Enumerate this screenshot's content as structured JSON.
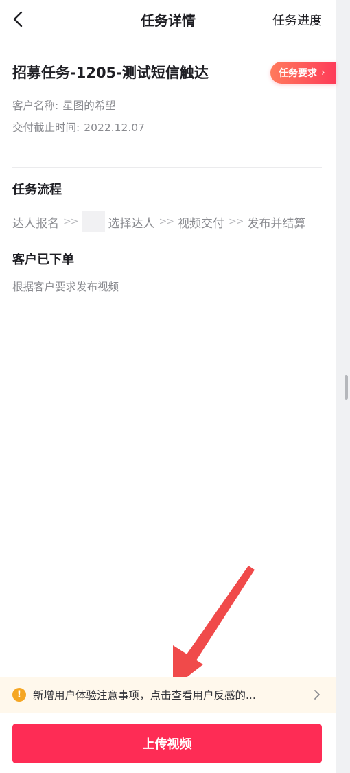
{
  "header": {
    "title": "任务详情",
    "progress_label": "任务进度"
  },
  "task": {
    "title": "招募任务-1205-测试短信触达",
    "requirements_badge": "任务要求",
    "customer_label": "客户名称:",
    "customer_value": "星图的希望",
    "deadline_label": "交付截止时间:",
    "deadline_value": "2022.12.07"
  },
  "flow": {
    "title": "任务流程",
    "separator": ">>",
    "steps": [
      "达人报名",
      "选择达人",
      "视频交付",
      "发布并结算"
    ]
  },
  "status": {
    "title": "客户已下单",
    "description": "根据客户要求发布视频"
  },
  "notice": {
    "icon": "warning-icon",
    "text": "新增用户体验注意事项，点击查看用户反感的..."
  },
  "bottom": {
    "upload_label": "上传视频"
  },
  "colors": {
    "accent": "#fe2c55",
    "badge_gradient_start": "#ff7a5c",
    "notice_bg": "#fff8ec",
    "warning": "#f5a623",
    "annotation_arrow": "#f04a4a"
  }
}
